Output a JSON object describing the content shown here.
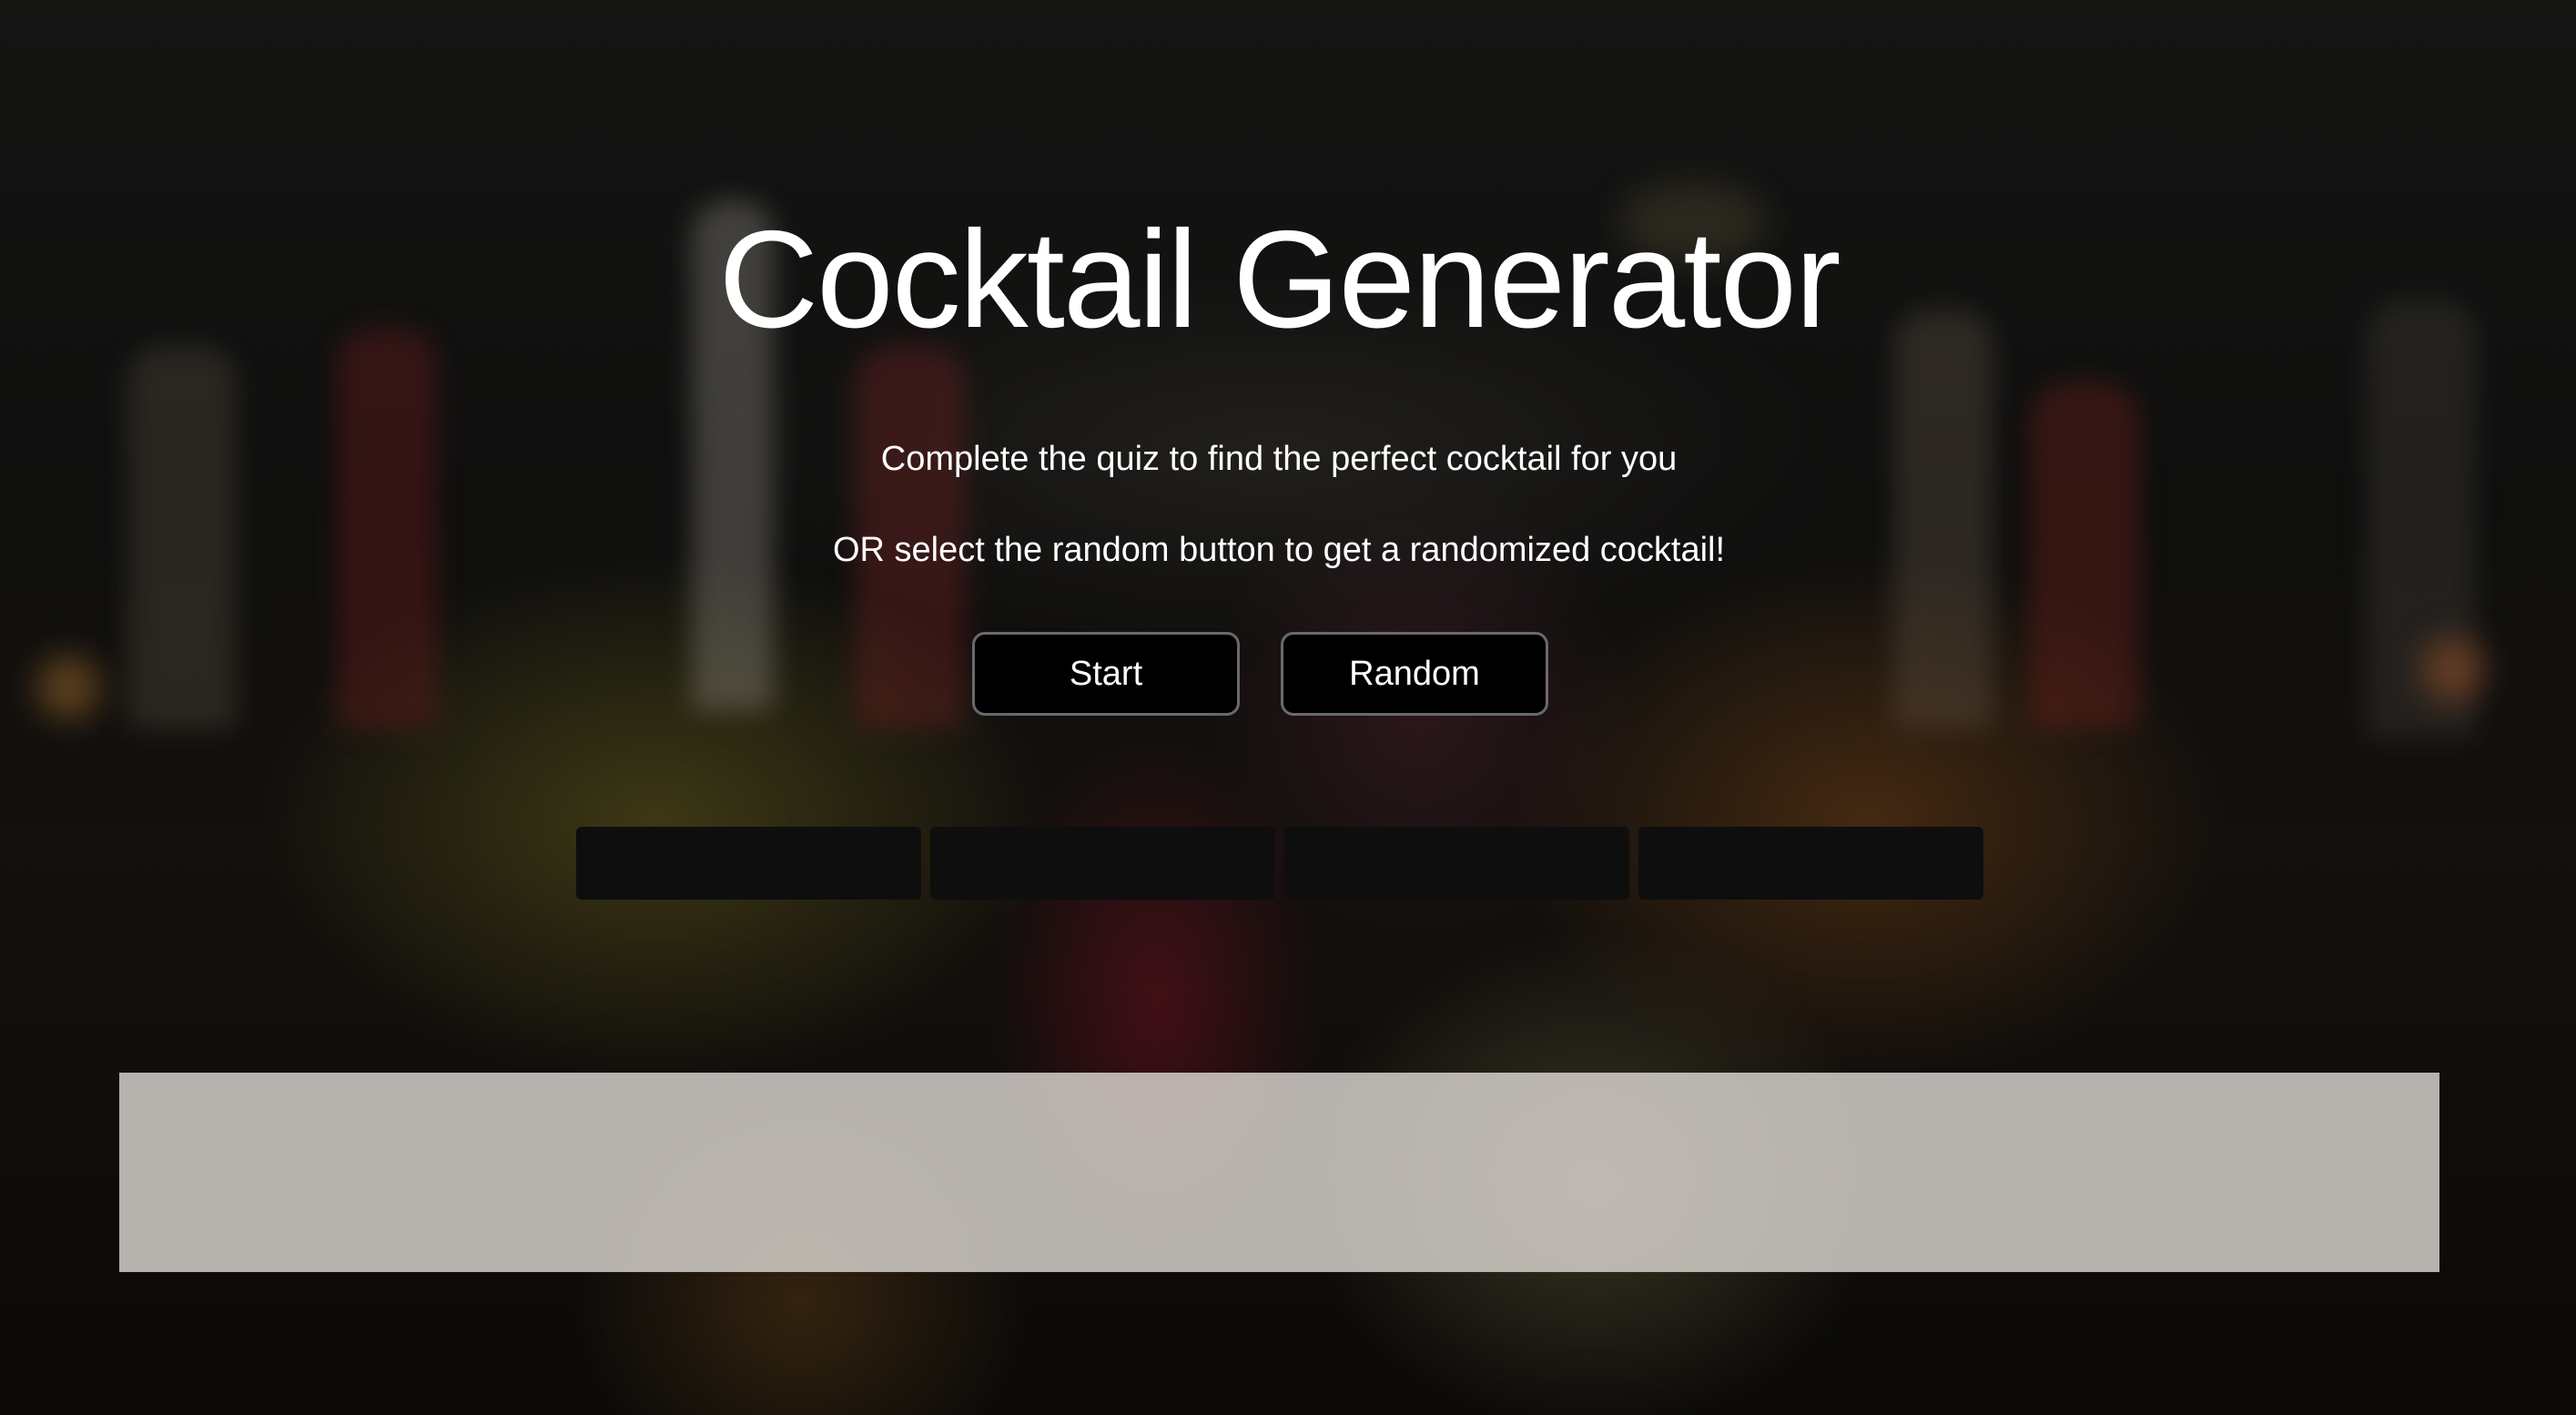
{
  "app": {
    "title": "Cocktail Generator",
    "subtitle_line1": "Complete the quiz to find the perfect cocktail for you",
    "subtitle_line2": "OR select the random button to get a randomized cocktail!"
  },
  "buttons": {
    "start_label": "Start",
    "random_label": "Random"
  },
  "question_options": [
    "",
    "",
    "",
    ""
  ],
  "result": {
    "text": ""
  },
  "colors": {
    "button_bg": "#000000",
    "option_bg": "#0e0e0e",
    "result_panel_bg": "#dcd7d2",
    "text": "#ffffff"
  }
}
